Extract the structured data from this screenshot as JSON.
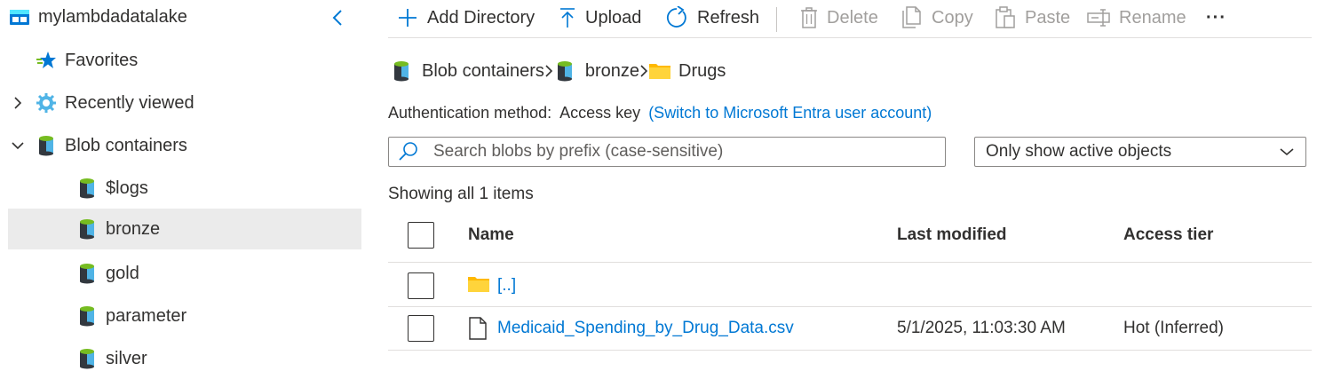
{
  "sidebar": {
    "account": "mylambdadatalake",
    "items": [
      {
        "label": "Favorites"
      },
      {
        "label": "Recently viewed"
      },
      {
        "label": "Blob containers"
      },
      {
        "label": "$logs"
      },
      {
        "label": "bronze"
      },
      {
        "label": "gold"
      },
      {
        "label": "parameter"
      },
      {
        "label": "silver"
      }
    ]
  },
  "toolbar": {
    "add_directory": "Add Directory",
    "upload": "Upload",
    "refresh": "Refresh",
    "delete": "Delete",
    "copy": "Copy",
    "paste": "Paste",
    "rename": "Rename",
    "more": "···"
  },
  "breadcrumb": [
    "Blob containers",
    "bronze",
    "Drugs"
  ],
  "auth": {
    "label": "Authentication method:",
    "value": "Access key",
    "switch_link": "(Switch to Microsoft Entra user account)"
  },
  "search": {
    "placeholder": "Search blobs by prefix (case-sensitive)",
    "value": ""
  },
  "filter": {
    "selected": "Only show active objects"
  },
  "showing": "Showing all 1 items",
  "table": {
    "columns": [
      "Name",
      "Last modified",
      "Access tier"
    ],
    "rows": [
      {
        "name": "[..]",
        "type": "folder",
        "modified": "",
        "tier": ""
      },
      {
        "name": "Medicaid_Spending_by_Drug_Data.csv",
        "type": "file",
        "modified": "5/1/2025, 11:03:30 AM",
        "tier": "Hot (Inferred)"
      }
    ]
  },
  "colors": {
    "accent": "#0078d4",
    "folder": "#ffb900",
    "selected_bg": "#ebebeb"
  }
}
